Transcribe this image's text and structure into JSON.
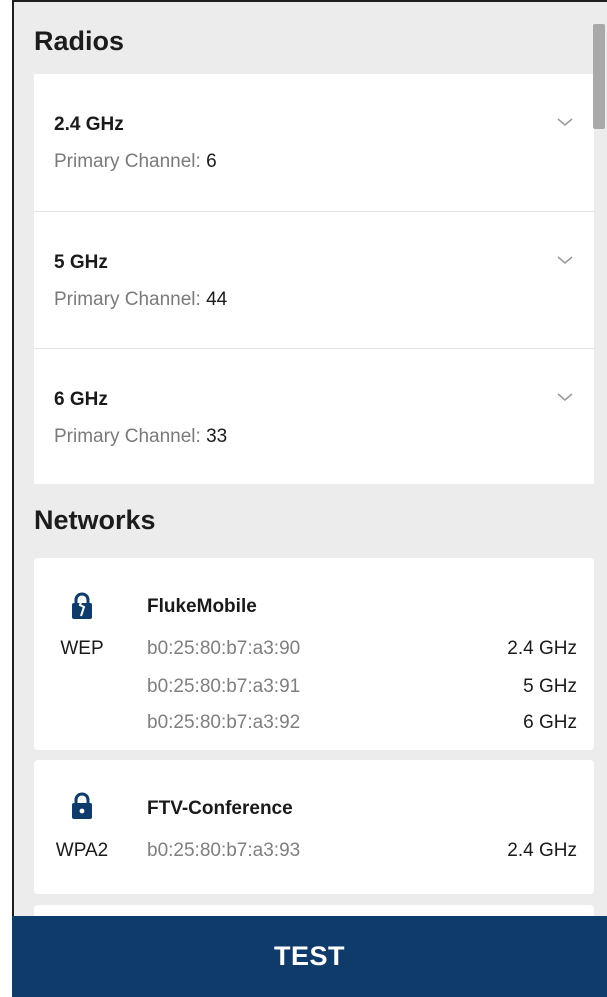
{
  "radios": {
    "title": "Radios",
    "items": [
      {
        "band": "2.4 GHz",
        "channel_label": "Primary Channel:",
        "channel": "6"
      },
      {
        "band": "5 GHz",
        "channel_label": "Primary Channel:",
        "channel": "44"
      },
      {
        "band": "6 GHz",
        "channel_label": "Primary Channel:",
        "channel": "33"
      }
    ]
  },
  "networks": {
    "title": "Networks",
    "items": [
      {
        "ssid": "FlukeMobile",
        "security": "WEP",
        "icon": "broken-lock-icon",
        "bssids": [
          {
            "mac": "b0:25:80:b7:a3:90",
            "band": "2.4 GHz"
          },
          {
            "mac": "b0:25:80:b7:a3:91",
            "band": "5 GHz"
          },
          {
            "mac": "b0:25:80:b7:a3:92",
            "band": "6 GHz"
          }
        ]
      },
      {
        "ssid": "FTV-Conference",
        "security": "WPA2",
        "icon": "lock-icon",
        "bssids": [
          {
            "mac": "b0:25:80:b7:a3:93",
            "band": "2.4 GHz"
          }
        ]
      }
    ]
  },
  "footer": {
    "test_label": "TEST"
  },
  "colors": {
    "accent": "#0f3b6b",
    "background": "#ececec",
    "icon": "#0f3b6b"
  }
}
